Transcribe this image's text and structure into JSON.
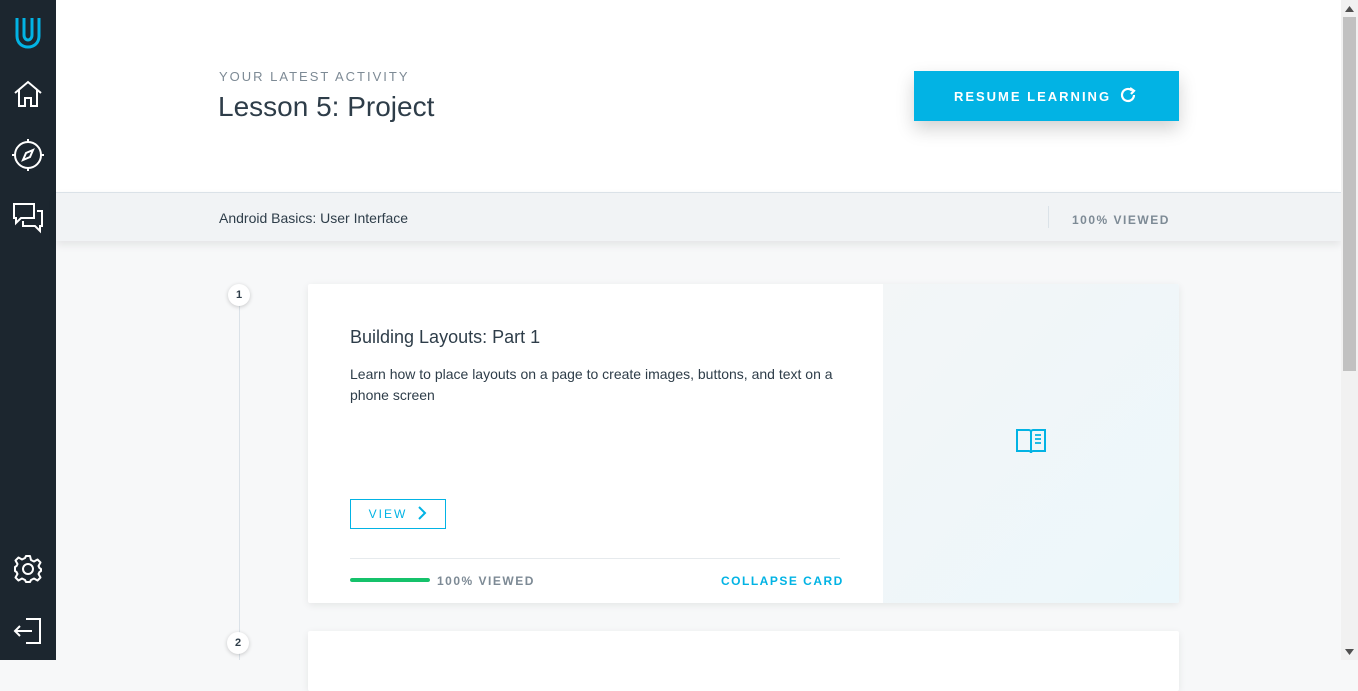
{
  "sidebar": {
    "items": [
      {
        "icon": "udacity-logo-icon"
      },
      {
        "icon": "home-icon"
      },
      {
        "icon": "compass-icon"
      },
      {
        "icon": "chat-icon"
      },
      {
        "icon": "gear-icon"
      },
      {
        "icon": "logout-icon"
      }
    ]
  },
  "header": {
    "eyebrow": "YOUR LATEST ACTIVITY",
    "title": "Lesson 5: Project",
    "resume_label": "RESUME LEARNING",
    "resume_icon": "refresh-icon"
  },
  "course": {
    "name": "Android Basics: User Interface",
    "status": "100% VIEWED"
  },
  "lessons": [
    {
      "number": "1",
      "title": "Building Layouts: Part 1",
      "description": "Learn how to place layouts on a page to create images, buttons, and text on a phone screen",
      "view_label": "VIEW",
      "progress_fraction": 1.0,
      "progress_label": "100% VIEWED",
      "collapse_label": "COLLAPSE CARD",
      "icon": "book-icon"
    },
    {
      "number": "2"
    }
  ],
  "colors": {
    "accent": "#02b3e4",
    "sidebar": "#1c262f",
    "progress": "#15c26b",
    "text": "#2e3d49",
    "muted": "#7d8a95"
  }
}
